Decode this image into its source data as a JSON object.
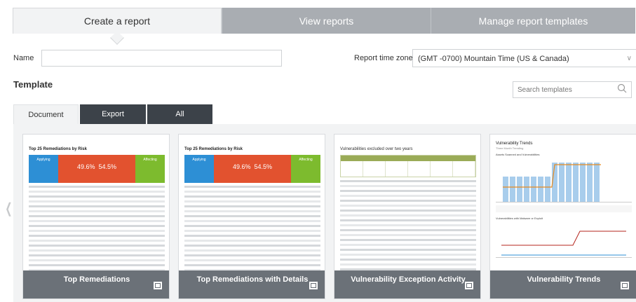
{
  "tabs": [
    {
      "label": "Create a report"
    },
    {
      "label": "View reports"
    },
    {
      "label": "Manage report templates"
    }
  ],
  "form": {
    "name_label": "Name",
    "name_value": "",
    "timezone_label": "Report time zone",
    "timezone_value": "(GMT -0700) Mountain Time (US & Canada)"
  },
  "template": {
    "title": "Template",
    "search_placeholder": "Search templates"
  },
  "subtabs": [
    {
      "label": "Document"
    },
    {
      "label": "Export"
    },
    {
      "label": "All"
    }
  ],
  "cards": [
    {
      "label": "Top Remediations",
      "thumb_title": "Top 25 Remediations by Risk",
      "thumb_applying": "Applying",
      "thumb_percent1": "49.6%",
      "thumb_percent2": "54.5%",
      "thumb_affecting": "Affecting"
    },
    {
      "label": "Top Remediations with Details",
      "thumb_title": "Top 25 Remediations by Risk",
      "thumb_applying": "Applying",
      "thumb_percent1": "49.6%",
      "thumb_percent2": "54.5%",
      "thumb_affecting": "Affecting"
    },
    {
      "label": "Vulnerability Exception Activity",
      "thumb_title": "Vulnerabilities excluded over two years"
    },
    {
      "label": "Vulnerability Trends",
      "thumb_title": "Vulnerability Trends",
      "thumb_sub": "Three Month Trending",
      "thumb_chart1": "Assets Scanned and Vulnerabilities",
      "thumb_chart2": "Vulnerabilities with Malware or Exploit"
    }
  ],
  "colors": {
    "tab_inactive": "#a9adb2",
    "subtab_dark": "#3c4249",
    "card_bar": "#6b7178",
    "accent_blue": "#2d8fd5",
    "accent_red": "#e2522f",
    "accent_green": "#7dbb2e"
  }
}
